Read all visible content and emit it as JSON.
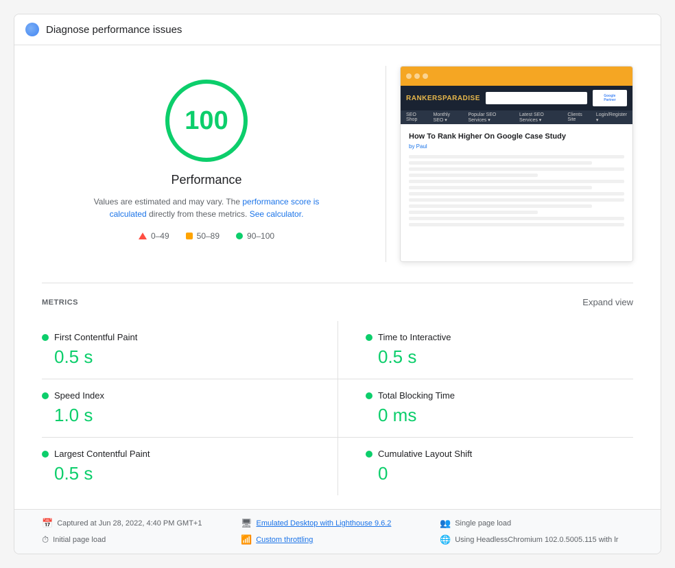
{
  "header": {
    "title": "Diagnose performance issues"
  },
  "score": {
    "value": "100",
    "label": "Performance",
    "description_prefix": "Values are estimated and may vary. The ",
    "description_link1": "performance score is calculated",
    "description_middle": " directly from these metrics. ",
    "description_link2": "See calculator.",
    "legend": [
      {
        "range": "0–49",
        "color": "red"
      },
      {
        "range": "50–89",
        "color": "orange"
      },
      {
        "range": "90–100",
        "color": "green"
      }
    ]
  },
  "screenshot": {
    "site_name": "RANKERSPARADISE",
    "article_title": "How To Rank Higher On Google Case Study",
    "article_author": "by Paul"
  },
  "metrics": {
    "section_title": "METRICS",
    "expand_label": "Expand view",
    "items": [
      {
        "name": "First Contentful Paint",
        "value": "0.5 s",
        "color": "#0cce6b"
      },
      {
        "name": "Time to Interactive",
        "value": "0.5 s",
        "color": "#0cce6b"
      },
      {
        "name": "Speed Index",
        "value": "1.0 s",
        "color": "#0cce6b"
      },
      {
        "name": "Total Blocking Time",
        "value": "0 ms",
        "color": "#0cce6b"
      },
      {
        "name": "Largest Contentful Paint",
        "value": "0.5 s",
        "color": "#0cce6b"
      },
      {
        "name": "Cumulative Layout Shift",
        "value": "0",
        "color": "#0cce6b"
      }
    ]
  },
  "footer": {
    "items": [
      {
        "icon": "📅",
        "text": "Captured at Jun 28, 2022, 4:40 PM GMT+1",
        "link": false
      },
      {
        "icon": "🖥",
        "text": "Emulated Desktop with Lighthouse 9.6.2",
        "link": true
      },
      {
        "icon": "👥",
        "text": "Single page load",
        "link": false
      },
      {
        "icon": "⏱",
        "text": "Initial page load",
        "link": false
      },
      {
        "icon": "📶",
        "text": "Custom throttling",
        "link": true
      },
      {
        "icon": "🌐",
        "text": "Using HeadlessChromium 102.0.5005.115 with lr",
        "link": false
      }
    ]
  }
}
